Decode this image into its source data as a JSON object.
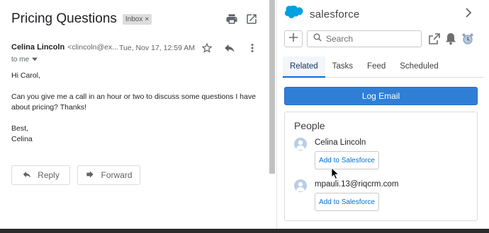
{
  "email": {
    "subject": "Pricing Questions",
    "inbox_chip": "Inbox",
    "chip_close": "×",
    "sender_name": "Celina Lincoln",
    "sender_email": "<clincoln@ex...",
    "date": "Tue, Nov 17, 12:59 AM",
    "recipient": "to me",
    "greeting": "Hi Carol,",
    "body": "Can you give me a call in an hour or two to discuss some questions I have about pricing? Thanks!",
    "signoff": "Best,",
    "signature": "Celina",
    "reply_label": "Reply",
    "forward_label": "Forward"
  },
  "salesforce": {
    "brand": "salesforce",
    "search_placeholder": "Search",
    "tabs": [
      {
        "label": "Related",
        "active": true
      },
      {
        "label": "Tasks",
        "active": false
      },
      {
        "label": "Feed",
        "active": false
      },
      {
        "label": "Scheduled",
        "active": false
      }
    ],
    "log_email_label": "Log Email",
    "people_title": "People",
    "people": [
      {
        "name": "Celina Lincoln",
        "button": "Add to Salesforce"
      },
      {
        "name": "mpauli.13@riqcrm.com",
        "button": "Add to Salesforce"
      }
    ],
    "brand_color": "#00a1e0",
    "accent_color": "#0070d2"
  },
  "icons": {
    "print": "print-icon",
    "open_new_window": "open-in-new-window-icon",
    "star": "star-icon",
    "reply": "reply-icon",
    "more": "more-vert-icon",
    "dropdown": "caret-down-icon",
    "forward": "forward-icon",
    "sf_logo": "salesforce-cloud-icon",
    "chevron_right": "chevron-right-icon",
    "plus": "plus-icon",
    "search": "search-icon",
    "external_link": "external-link-icon",
    "bell": "bell-icon",
    "alarm": "alarm-clock-icon",
    "avatar": "person-avatar-icon"
  }
}
